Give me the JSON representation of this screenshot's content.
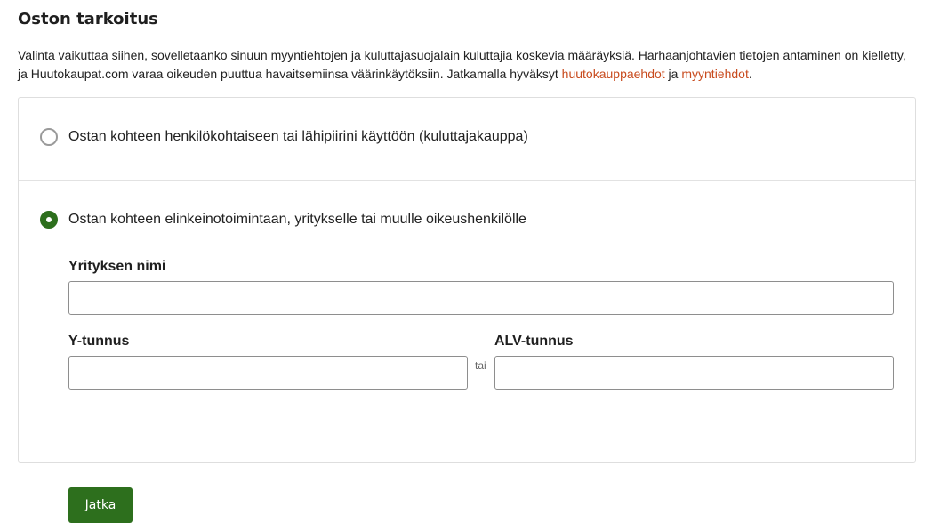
{
  "section": {
    "title": "Oston tarkoitus",
    "intro_text": "Valinta vaikuttaa siihen, sovelletaanko sinuun myyntiehtojen ja kuluttajasuojalain kuluttajia koskevia määräyksiä. Harhaanjohtavien tietojen antaminen on kielletty, ja Huutokaupat.com varaa oikeuden puuttua havaitsemiinsa väärinkäytöksiin. Jatkamalla hyväksyt ",
    "link1": "huutokauppaehdot",
    "conjunction": " ja ",
    "link2": "myyntiehdot",
    "period": "."
  },
  "options": {
    "consumer": {
      "label": "Ostan kohteen henkilökohtaiseen tai lähipiirini käyttöön (kuluttajakauppa)",
      "selected": false
    },
    "business": {
      "label": "Ostan kohteen elinkeinotoimintaan, yritykselle tai muulle oikeushenkilölle",
      "selected": true
    }
  },
  "form": {
    "company_name_label": "Yrityksen nimi",
    "company_name_value": "",
    "y_tunnus_label": "Y-tunnus",
    "y_tunnus_value": "",
    "or_label": "tai",
    "alv_label": "ALV-tunnus",
    "alv_value": "",
    "continue_label": "Jatka"
  },
  "colors": {
    "accent_green": "#2d6f1d",
    "link_orange": "#c84b1e"
  }
}
